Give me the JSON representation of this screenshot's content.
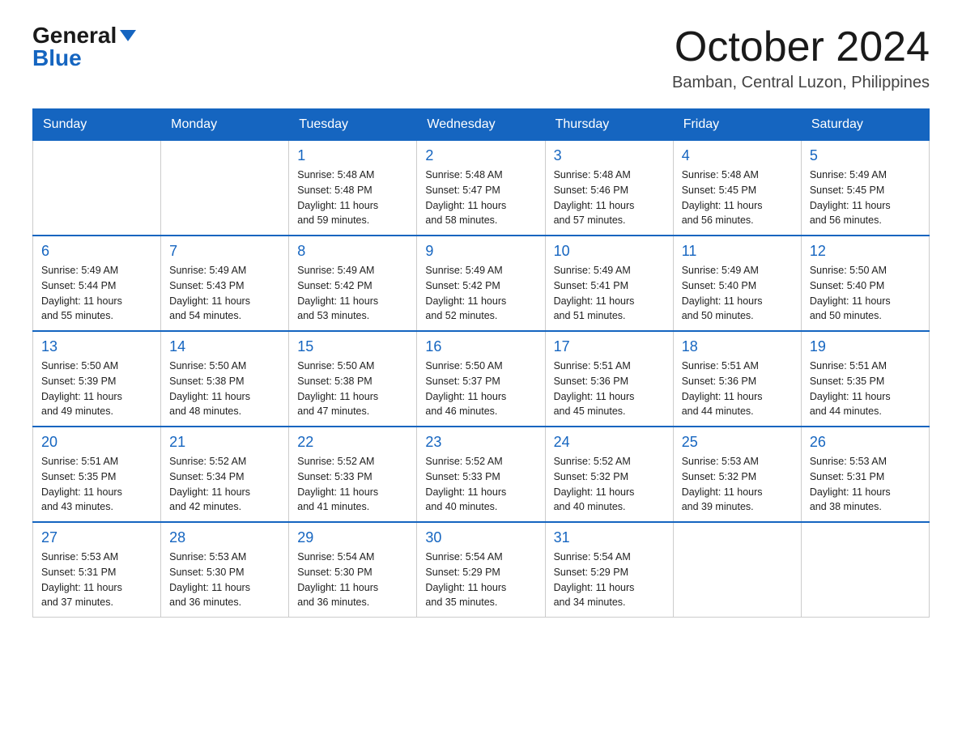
{
  "header": {
    "logo_general": "General",
    "logo_blue": "Blue",
    "month_title": "October 2024",
    "location": "Bamban, Central Luzon, Philippines"
  },
  "weekdays": [
    "Sunday",
    "Monday",
    "Tuesday",
    "Wednesday",
    "Thursday",
    "Friday",
    "Saturday"
  ],
  "weeks": [
    [
      {
        "day": "",
        "info": ""
      },
      {
        "day": "",
        "info": ""
      },
      {
        "day": "1",
        "info": "Sunrise: 5:48 AM\nSunset: 5:48 PM\nDaylight: 11 hours\nand 59 minutes."
      },
      {
        "day": "2",
        "info": "Sunrise: 5:48 AM\nSunset: 5:47 PM\nDaylight: 11 hours\nand 58 minutes."
      },
      {
        "day": "3",
        "info": "Sunrise: 5:48 AM\nSunset: 5:46 PM\nDaylight: 11 hours\nand 57 minutes."
      },
      {
        "day": "4",
        "info": "Sunrise: 5:48 AM\nSunset: 5:45 PM\nDaylight: 11 hours\nand 56 minutes."
      },
      {
        "day": "5",
        "info": "Sunrise: 5:49 AM\nSunset: 5:45 PM\nDaylight: 11 hours\nand 56 minutes."
      }
    ],
    [
      {
        "day": "6",
        "info": "Sunrise: 5:49 AM\nSunset: 5:44 PM\nDaylight: 11 hours\nand 55 minutes."
      },
      {
        "day": "7",
        "info": "Sunrise: 5:49 AM\nSunset: 5:43 PM\nDaylight: 11 hours\nand 54 minutes."
      },
      {
        "day": "8",
        "info": "Sunrise: 5:49 AM\nSunset: 5:42 PM\nDaylight: 11 hours\nand 53 minutes."
      },
      {
        "day": "9",
        "info": "Sunrise: 5:49 AM\nSunset: 5:42 PM\nDaylight: 11 hours\nand 52 minutes."
      },
      {
        "day": "10",
        "info": "Sunrise: 5:49 AM\nSunset: 5:41 PM\nDaylight: 11 hours\nand 51 minutes."
      },
      {
        "day": "11",
        "info": "Sunrise: 5:49 AM\nSunset: 5:40 PM\nDaylight: 11 hours\nand 50 minutes."
      },
      {
        "day": "12",
        "info": "Sunrise: 5:50 AM\nSunset: 5:40 PM\nDaylight: 11 hours\nand 50 minutes."
      }
    ],
    [
      {
        "day": "13",
        "info": "Sunrise: 5:50 AM\nSunset: 5:39 PM\nDaylight: 11 hours\nand 49 minutes."
      },
      {
        "day": "14",
        "info": "Sunrise: 5:50 AM\nSunset: 5:38 PM\nDaylight: 11 hours\nand 48 minutes."
      },
      {
        "day": "15",
        "info": "Sunrise: 5:50 AM\nSunset: 5:38 PM\nDaylight: 11 hours\nand 47 minutes."
      },
      {
        "day": "16",
        "info": "Sunrise: 5:50 AM\nSunset: 5:37 PM\nDaylight: 11 hours\nand 46 minutes."
      },
      {
        "day": "17",
        "info": "Sunrise: 5:51 AM\nSunset: 5:36 PM\nDaylight: 11 hours\nand 45 minutes."
      },
      {
        "day": "18",
        "info": "Sunrise: 5:51 AM\nSunset: 5:36 PM\nDaylight: 11 hours\nand 44 minutes."
      },
      {
        "day": "19",
        "info": "Sunrise: 5:51 AM\nSunset: 5:35 PM\nDaylight: 11 hours\nand 44 minutes."
      }
    ],
    [
      {
        "day": "20",
        "info": "Sunrise: 5:51 AM\nSunset: 5:35 PM\nDaylight: 11 hours\nand 43 minutes."
      },
      {
        "day": "21",
        "info": "Sunrise: 5:52 AM\nSunset: 5:34 PM\nDaylight: 11 hours\nand 42 minutes."
      },
      {
        "day": "22",
        "info": "Sunrise: 5:52 AM\nSunset: 5:33 PM\nDaylight: 11 hours\nand 41 minutes."
      },
      {
        "day": "23",
        "info": "Sunrise: 5:52 AM\nSunset: 5:33 PM\nDaylight: 11 hours\nand 40 minutes."
      },
      {
        "day": "24",
        "info": "Sunrise: 5:52 AM\nSunset: 5:32 PM\nDaylight: 11 hours\nand 40 minutes."
      },
      {
        "day": "25",
        "info": "Sunrise: 5:53 AM\nSunset: 5:32 PM\nDaylight: 11 hours\nand 39 minutes."
      },
      {
        "day": "26",
        "info": "Sunrise: 5:53 AM\nSunset: 5:31 PM\nDaylight: 11 hours\nand 38 minutes."
      }
    ],
    [
      {
        "day": "27",
        "info": "Sunrise: 5:53 AM\nSunset: 5:31 PM\nDaylight: 11 hours\nand 37 minutes."
      },
      {
        "day": "28",
        "info": "Sunrise: 5:53 AM\nSunset: 5:30 PM\nDaylight: 11 hours\nand 36 minutes."
      },
      {
        "day": "29",
        "info": "Sunrise: 5:54 AM\nSunset: 5:30 PM\nDaylight: 11 hours\nand 36 minutes."
      },
      {
        "day": "30",
        "info": "Sunrise: 5:54 AM\nSunset: 5:29 PM\nDaylight: 11 hours\nand 35 minutes."
      },
      {
        "day": "31",
        "info": "Sunrise: 5:54 AM\nSunset: 5:29 PM\nDaylight: 11 hours\nand 34 minutes."
      },
      {
        "day": "",
        "info": ""
      },
      {
        "day": "",
        "info": ""
      }
    ]
  ]
}
